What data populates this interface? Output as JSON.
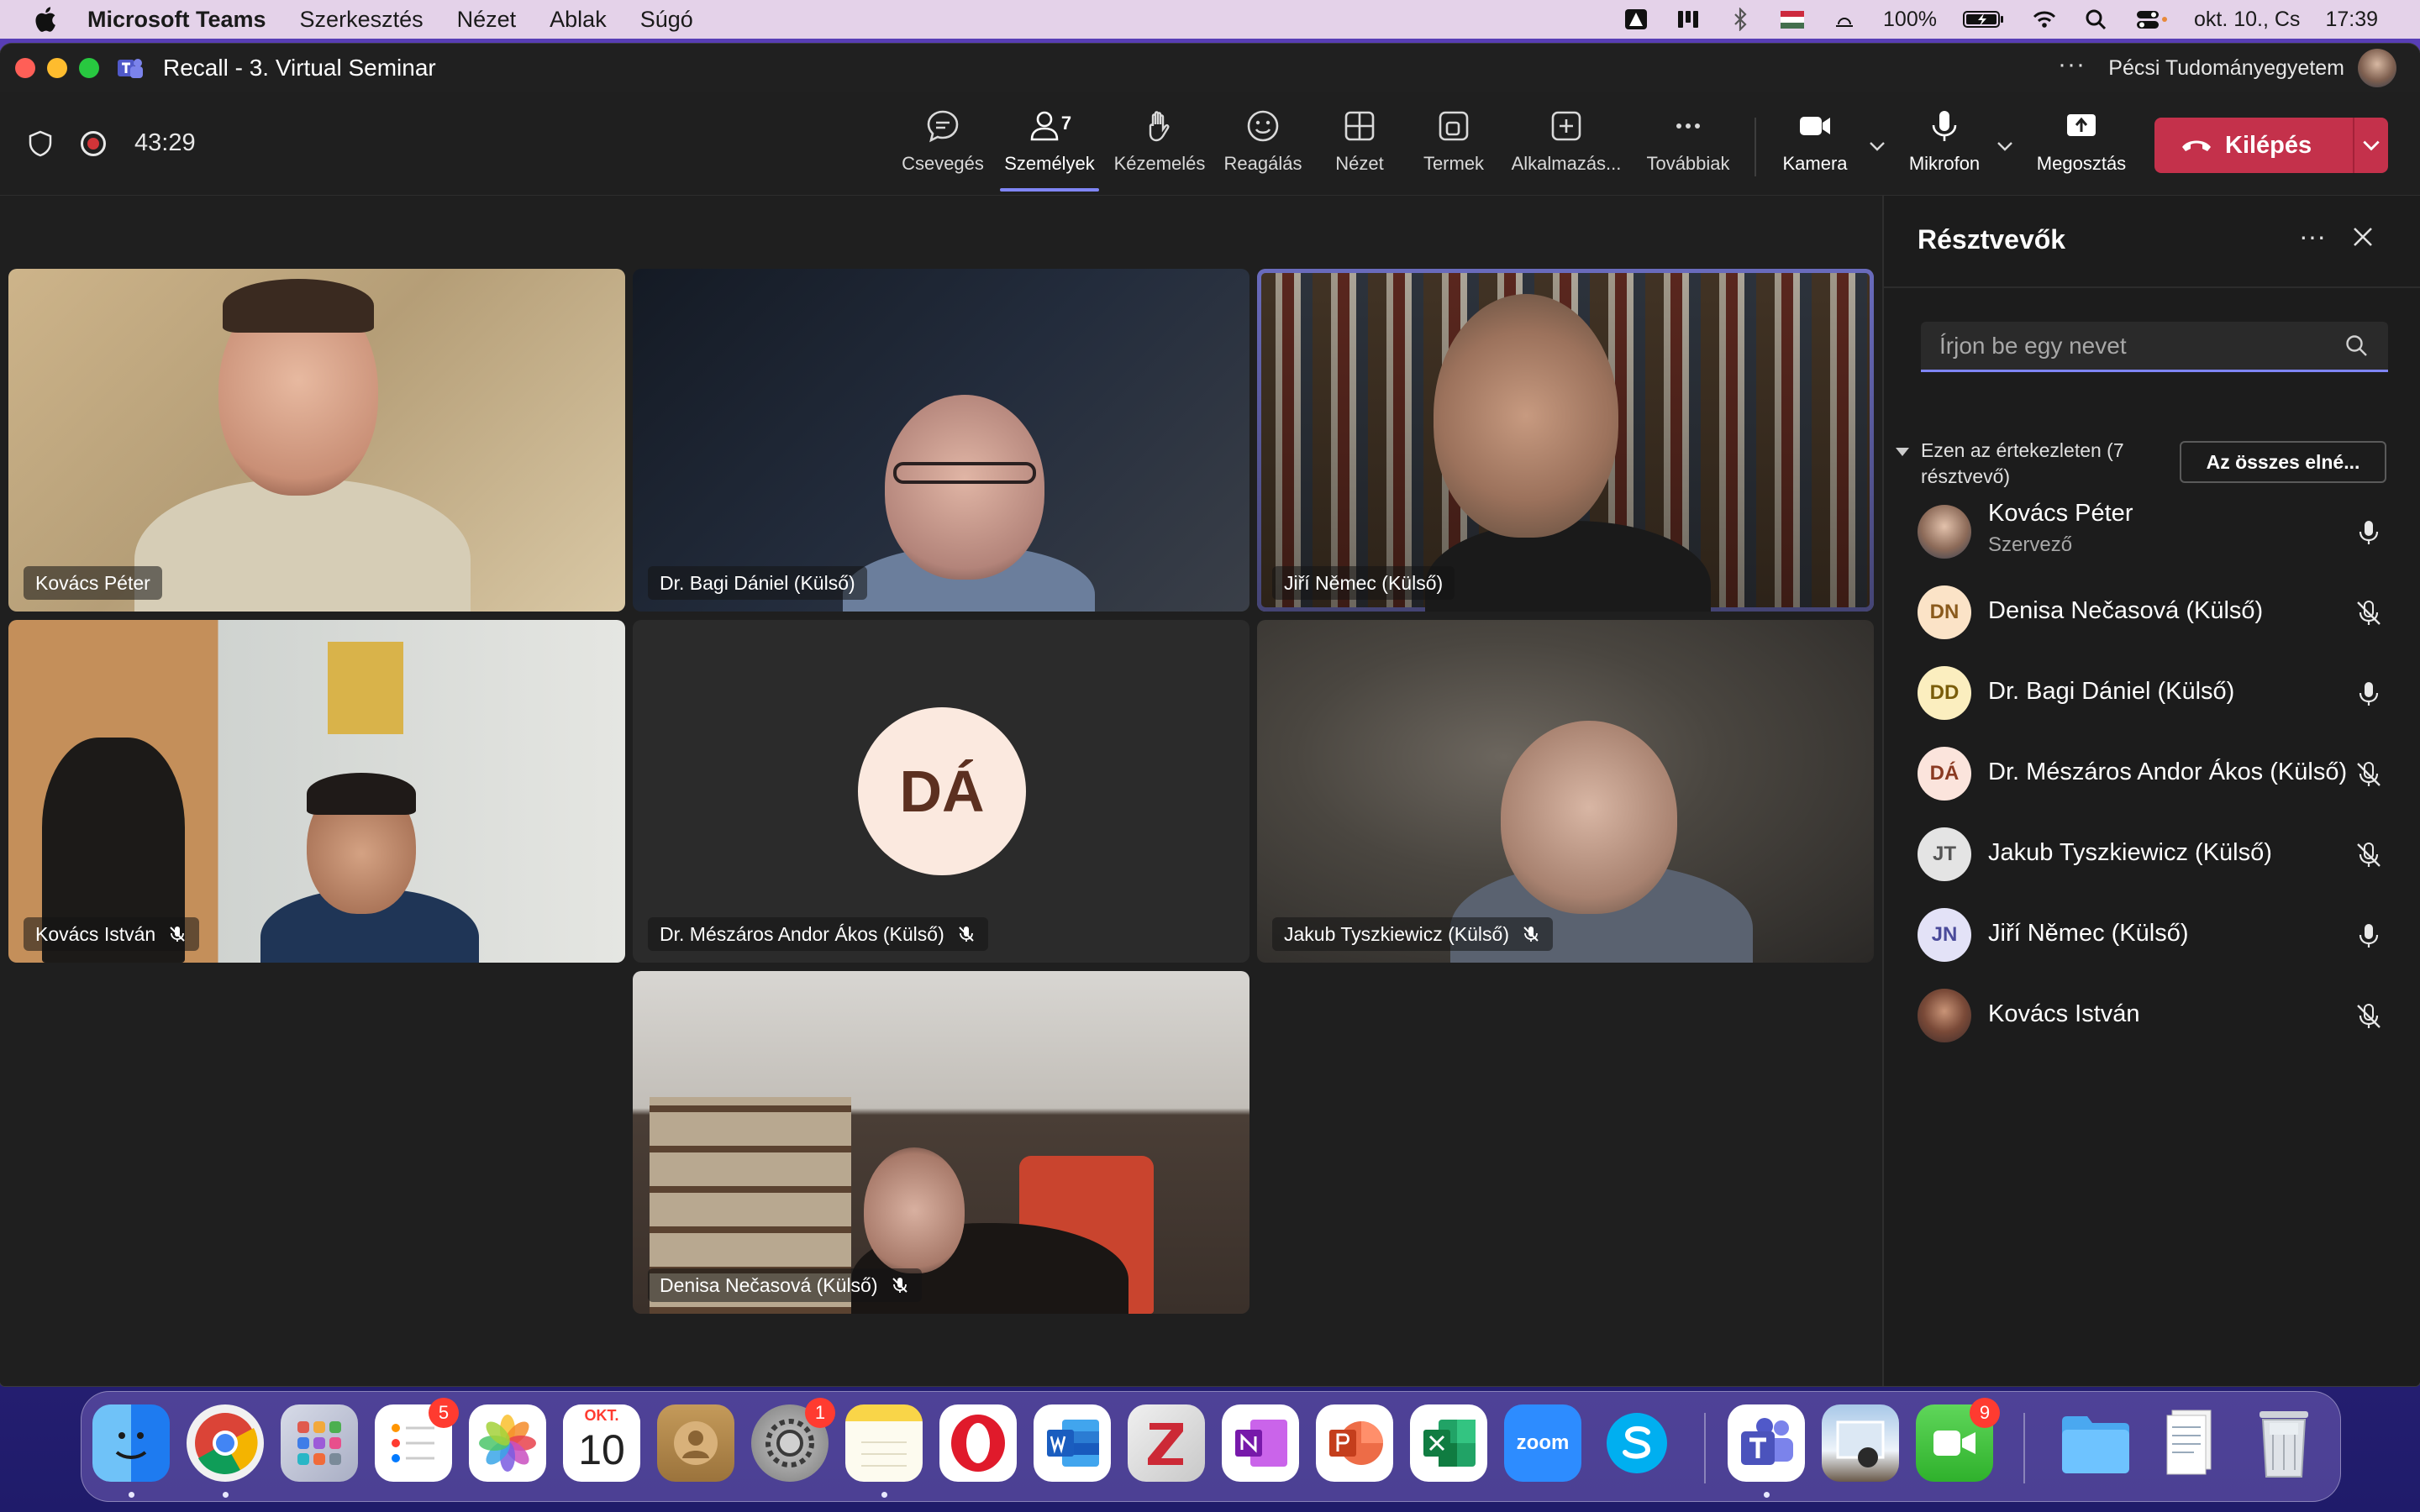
{
  "menubar": {
    "app": "Microsoft Teams",
    "items": [
      "Szerkesztés",
      "Nézet",
      "Ablak",
      "Súgó"
    ],
    "battery": "100%",
    "date": "okt. 10., Cs",
    "time": "17:39"
  },
  "window": {
    "title": "Recall - 3. Virtual Seminar",
    "org": "Pécsi Tudományegyetem",
    "more": "···"
  },
  "toolbar": {
    "elapsed": "43:29",
    "chat": "Csevegés",
    "people": "Személyek",
    "people_count": "7",
    "raise_hand": "Kézemelés",
    "react": "Reagálás",
    "view": "Nézet",
    "rooms": "Termek",
    "apps": "Alkalmazás...",
    "more": "Továbbiak",
    "camera": "Kamera",
    "mic": "Mikrofon",
    "share": "Megosztás",
    "leave": "Kilépés"
  },
  "tiles": [
    {
      "name": "Kovács Péter",
      "muted": false
    },
    {
      "name": "Dr. Bagi Dániel (Külső)",
      "muted": false
    },
    {
      "name": "Jiří Němec (Külső)",
      "muted": false,
      "speaking": true
    },
    {
      "name": "Kovács István",
      "muted": true
    },
    {
      "name": "Dr. Mészáros Andor Ákos (Külső)",
      "muted": true,
      "initials": "DÁ"
    },
    {
      "name": "Jakub Tyszkiewicz (Külső)",
      "muted": true
    },
    {
      "name": "Denisa Nečasová (Külső)",
      "muted": true
    }
  ],
  "panel": {
    "title": "Résztvevők",
    "more": "···",
    "search_placeholder": "Írjon be egy nevet",
    "section": "Ezen az értekezleten (7 résztvevő)",
    "mute_all": "Az összes elné...",
    "participants": [
      {
        "name": "Kovács Péter",
        "role": "Szervező",
        "initials": "",
        "muted": false
      },
      {
        "name": "Denisa Nečasová (Külső)",
        "initials": "DN",
        "muted": true
      },
      {
        "name": "Dr. Bagi Dániel (Külső)",
        "initials": "DD",
        "muted": false
      },
      {
        "name": "Dr. Mészáros Andor Ákos (Külső)",
        "initials": "DÁ",
        "muted": true
      },
      {
        "name": "Jakub Tyszkiewicz (Külső)",
        "initials": "JT",
        "muted": true
      },
      {
        "name": "Jiří Němec (Külső)",
        "initials": "JN",
        "muted": false
      },
      {
        "name": "Kovács István",
        "initials": "",
        "muted": true
      }
    ]
  },
  "dock": {
    "calendar_month": "OKT.",
    "calendar_day": "10",
    "reminders_badge": "5",
    "settings_badge": "1",
    "facetime_badge": "9",
    "zoom_label": "zoom"
  },
  "colors": {
    "accent": "#7f85f5",
    "leave": "#c4314b",
    "menubar": "#e4d2e9"
  }
}
